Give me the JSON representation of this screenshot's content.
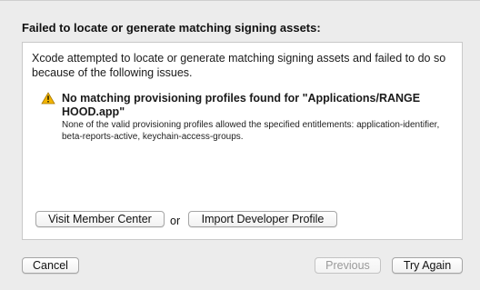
{
  "dialog": {
    "title": "Failed to locate or generate matching signing assets:",
    "message": "Xcode attempted to locate or generate matching signing assets and failed to do so because of the following issues.",
    "issue": {
      "title": "No matching provisioning profiles found for \"Applications/RANGE HOOD.app\"",
      "detail": "None of the valid provisioning profiles allowed the specified entitlements: application-identifier, beta-reports-active, keychain-access-groups."
    },
    "actions": {
      "visit_member_center": "Visit Member Center",
      "or": "or",
      "import_developer_profile": "Import Developer Profile"
    },
    "footer": {
      "cancel": "Cancel",
      "previous": "Previous",
      "try_again": "Try Again"
    },
    "icons": {
      "warning": "warning-icon"
    },
    "colors": {
      "warning": "#f2b400",
      "disabled_text": "#9a9a9a"
    }
  }
}
